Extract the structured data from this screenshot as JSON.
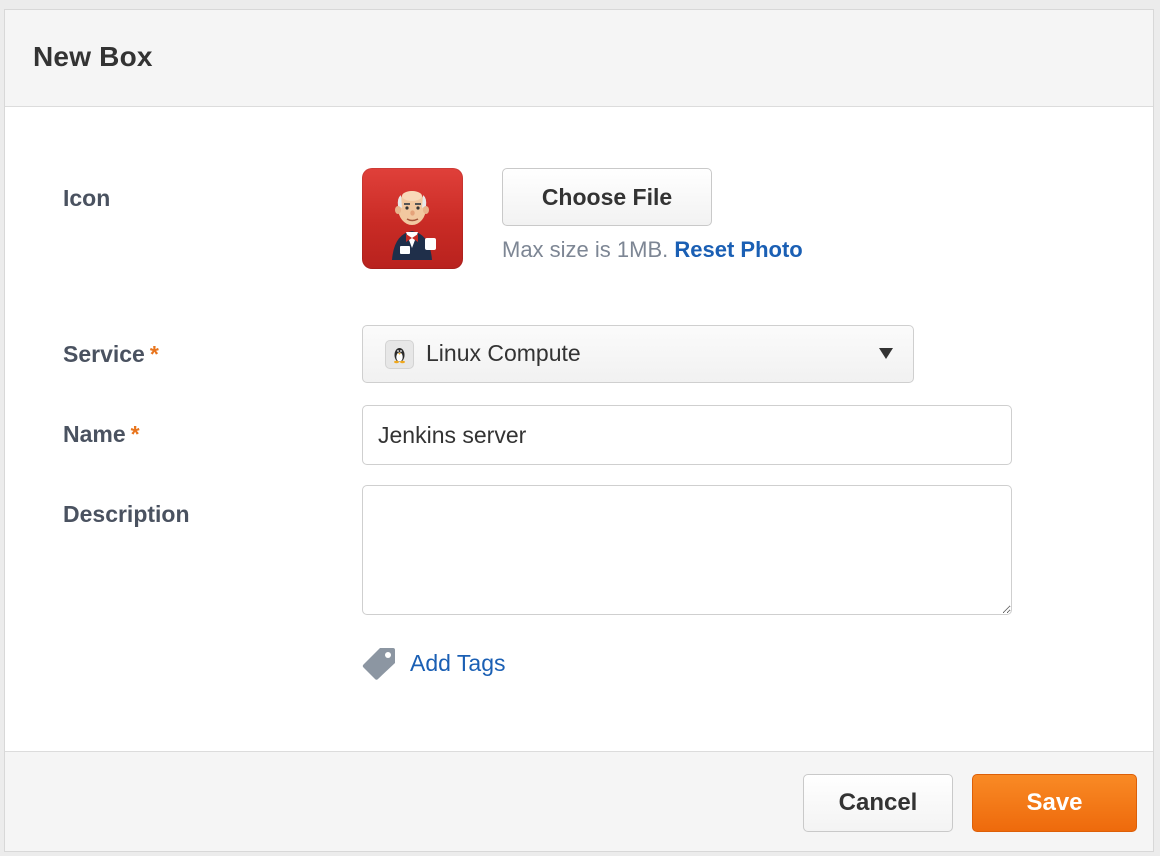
{
  "dialog": {
    "title": "New Box"
  },
  "form": {
    "icon": {
      "label": "Icon",
      "image": "jenkins-butler-icon",
      "choose_label": "Choose File",
      "hint": "Max size is 1MB.",
      "reset_label": "Reset Photo"
    },
    "service": {
      "label": "Service",
      "required_marker": "*",
      "selected": "Linux Compute",
      "option_icon": "linux-penguin-icon"
    },
    "name": {
      "label": "Name",
      "required_marker": "*",
      "value": "Jenkins server"
    },
    "description": {
      "label": "Description",
      "value": ""
    },
    "tags": {
      "label": "Add Tags",
      "icon": "tag-icon"
    }
  },
  "footer": {
    "cancel_label": "Cancel",
    "save_label": "Save"
  },
  "colors": {
    "accent_orange": "#ee6a0c",
    "link_blue": "#1a5fb4",
    "required_orange": "#e8741c",
    "icon_red": "#c92b25"
  }
}
